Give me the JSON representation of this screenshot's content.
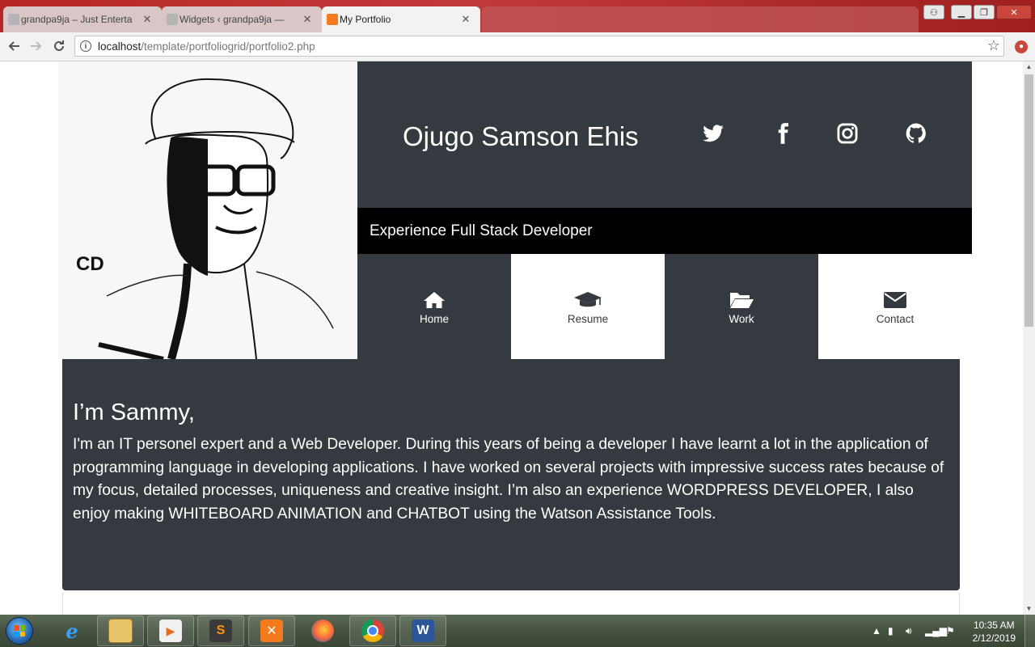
{
  "browser": {
    "tabs": [
      {
        "title": "grandpa9ja – Just Enterta",
        "active": false
      },
      {
        "title": "Widgets ‹ grandpa9ja —",
        "active": false
      },
      {
        "title": "My Portfolio",
        "active": true
      }
    ],
    "address": {
      "host": "localhost",
      "path": "/template/portfoliogrid/portfolio2.php"
    }
  },
  "portfolio": {
    "name": "Ojugo Samson Ehis",
    "tagline": "Experience Full Stack Developer",
    "portrait_logo": "CD",
    "social": [
      {
        "icon": "twitter-icon"
      },
      {
        "icon": "facebook-icon"
      },
      {
        "icon": "instagram-icon"
      },
      {
        "icon": "github-icon"
      }
    ],
    "nav": [
      {
        "label": "Home",
        "icon": "home-icon"
      },
      {
        "label": "Resume",
        "icon": "graduation-cap-icon"
      },
      {
        "label": "Work",
        "icon": "folder-open-icon"
      },
      {
        "label": "Contact",
        "icon": "envelope-icon"
      }
    ],
    "about": {
      "heading": "I’m Sammy,",
      "body": "I'm an IT personel expert and a Web Developer. During this years of being a developer I have learnt a lot in the application of programming language in developing applications. I have worked on several projects with impressive success rates because of my focus, detailed processes, uniqueness and creative insight. I’m also an experience WORDPRESS DEVELOPER, I also enjoy making WHITEBOARD ANIMATION and CHATBOT using the Watson Assistance Tools."
    }
  },
  "taskbar": {
    "apps": [
      "internet-explorer",
      "file-explorer",
      "media-player",
      "sublime-text",
      "xampp",
      "firefox",
      "chrome",
      "word"
    ],
    "clock": {
      "time": "10:35 AM",
      "date": "2/12/2019"
    }
  },
  "colors": {
    "dark": "#343a40",
    "black": "#000000",
    "chrome_frame": "#b82a2a"
  }
}
